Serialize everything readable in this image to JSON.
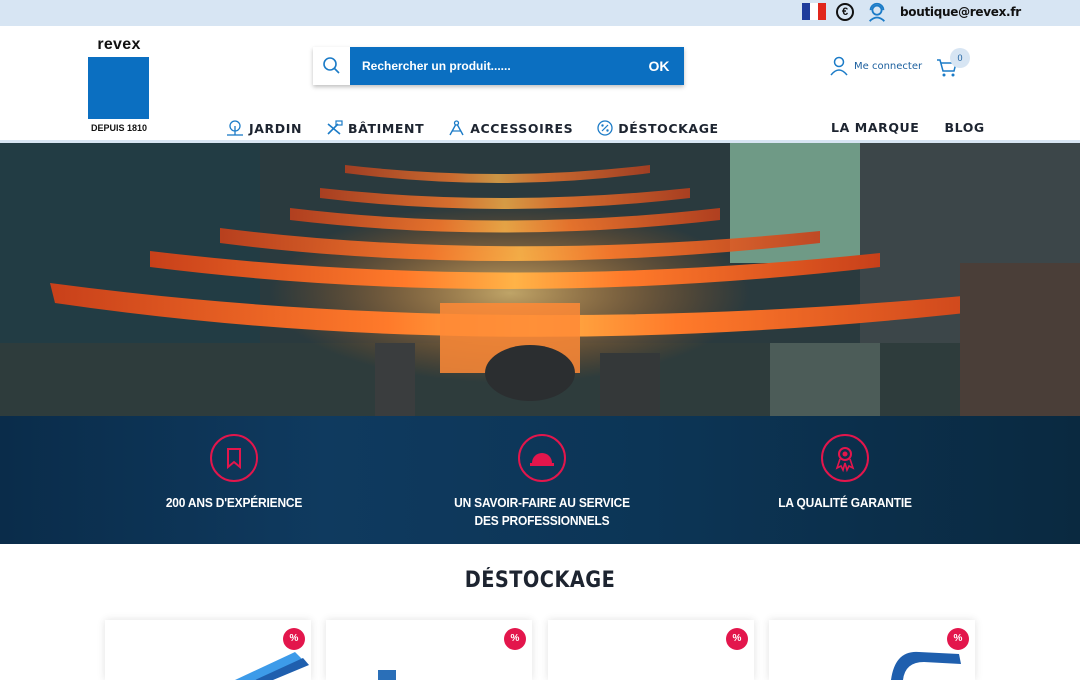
{
  "topbar": {
    "email": "boutique@revex.fr",
    "icons": [
      "france-flag-icon",
      "euro-icon",
      "support-headset-icon"
    ],
    "flag_colors": [
      "#1f3c9c",
      "#ffffff",
      "#e1261c"
    ]
  },
  "logo": {
    "name": "revex",
    "since": "DEPUIS 1810",
    "color": "#0b6fc1"
  },
  "search": {
    "placeholder": "Rechercher un produit......",
    "button": "OK"
  },
  "account": {
    "login_label": "Me connecter",
    "cart_count": "0"
  },
  "nav": {
    "items": [
      {
        "label": "JARDIN",
        "icon": "tree-icon"
      },
      {
        "label": "BÂTIMENT",
        "icon": "hammer-icon"
      },
      {
        "label": "ACCESSOIRES",
        "icon": "compass-icon"
      },
      {
        "label": "DÉSTOCKAGE",
        "icon": "percent-icon"
      }
    ],
    "right": [
      {
        "label": "LA MARQUE"
      },
      {
        "label": "BLOG"
      }
    ]
  },
  "features": [
    {
      "icon": "bookmark-icon",
      "line1": "200 ANS D'EXPÉRIENCE",
      "line2": ""
    },
    {
      "icon": "hard-hat-icon",
      "line1": "UN SAVOIR-FAIRE AU SERVICE",
      "line2": "DES PROFESSIONNELS"
    },
    {
      "icon": "award-ribbon-icon",
      "line1": "LA QUALITÉ GARANTIE",
      "line2": ""
    }
  ],
  "section": {
    "title": "DÉSTOCKAGE"
  },
  "products": [
    {
      "badge": "%"
    },
    {
      "badge": "%"
    },
    {
      "badge": "%"
    },
    {
      "badge": "%"
    }
  ],
  "colors": {
    "primary": "#0b6fc1",
    "accent": "#e3164c",
    "topbar": "#d7e5f3"
  }
}
